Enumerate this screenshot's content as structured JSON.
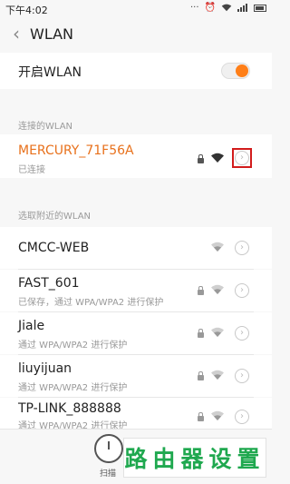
{
  "status_bar": {
    "time": "下午4:02"
  },
  "header": {
    "title": "WLAN"
  },
  "wlan_toggle": {
    "label": "开启WLAN",
    "enabled": true
  },
  "sections": {
    "connected_header": "连接的WLAN",
    "nearby_header": "选取附近的WLAN"
  },
  "connected": {
    "ssid": "MERCURY_71F56A",
    "status": "已连接",
    "accent": "#e8711c"
  },
  "networks": [
    {
      "ssid": "CMCC-WEB",
      "status": ""
    },
    {
      "ssid": "FAST_601",
      "status": "已保存，通过 WPA/WPA2 进行保护"
    },
    {
      "ssid": "Jiale",
      "status": "通过 WPA/WPA2 进行保护"
    },
    {
      "ssid": "liuyijuan",
      "status": "通过 WPA/WPA2 进行保护"
    },
    {
      "ssid": "TP-LINK_888888",
      "status": "通过 WPA/WPA2 进行保护"
    }
  ],
  "bottom": {
    "scan_label": "扫描"
  },
  "watermark": {
    "text": "路由器设置"
  },
  "colors": {
    "accent_orange": "#ff7f18",
    "highlight_red": "#d21c1c",
    "watermark_green": "#1fa84f"
  }
}
